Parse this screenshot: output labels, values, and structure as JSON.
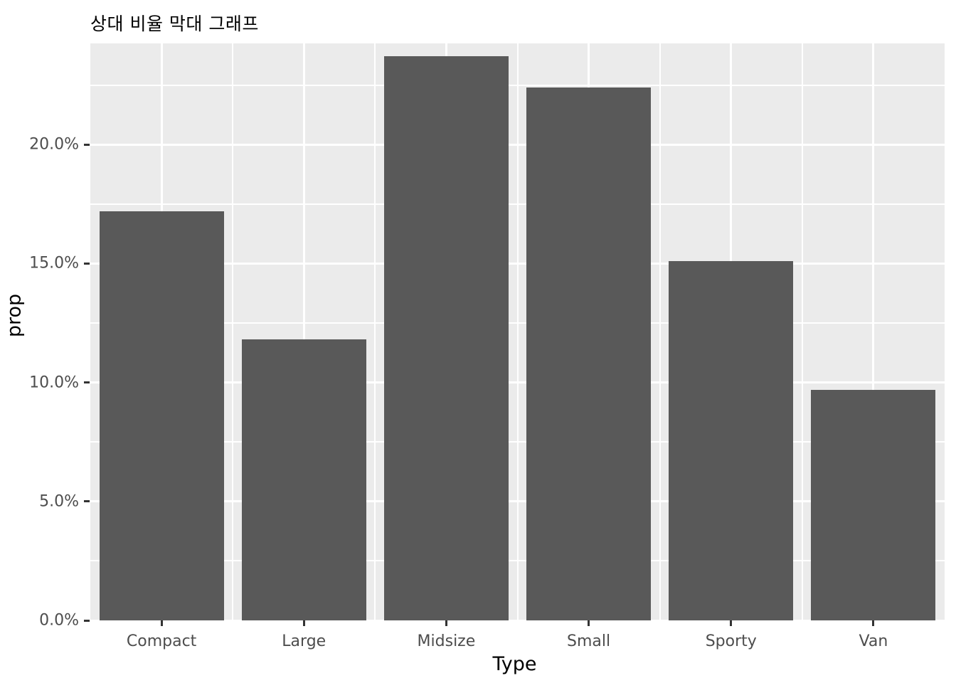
{
  "chart_data": {
    "type": "bar",
    "title": "상대 비율 막대 그래프",
    "xlabel": "Type",
    "ylabel": "prop",
    "categories": [
      "Compact",
      "Large",
      "Midsize",
      "Small",
      "Sporty",
      "Van"
    ],
    "values": [
      0.172,
      0.118,
      0.237,
      0.224,
      0.151,
      0.097
    ],
    "value_labels": [
      "17.2%",
      "11.8%",
      "23.7%",
      "22.4%",
      "15.1%",
      "9.7%"
    ],
    "ylim": [
      0,
      0.2425
    ],
    "y_ticks": [
      0,
      0.05,
      0.1,
      0.15,
      0.2
    ],
    "y_tick_labels": [
      "0.0%",
      "5.0%",
      "10.0%",
      "15.0%",
      "20.0%"
    ],
    "y_minor_ticks": [
      0.025,
      0.075,
      0.125,
      0.175,
      0.225
    ],
    "grid": true,
    "legend": "none",
    "bar_color": "#595959",
    "panel_background": "#EBEBEB",
    "grid_color": "#FFFFFF",
    "axis_text_color": "#4D4D4D",
    "axis_title_color": "#000000"
  }
}
